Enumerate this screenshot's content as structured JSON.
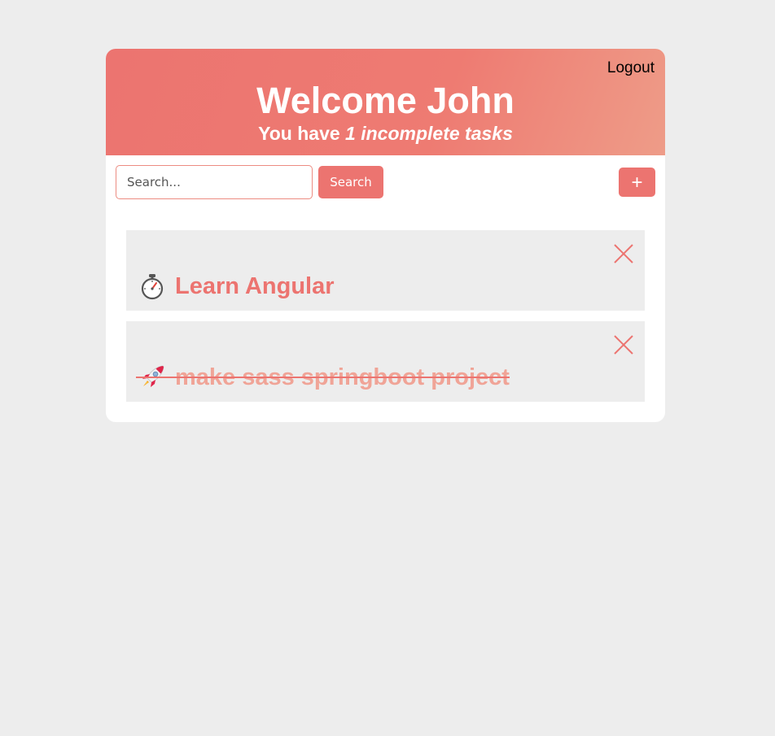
{
  "header": {
    "logout_label": "Logout",
    "welcome_prefix": "Welcome",
    "user_name": "John",
    "subtitle_prefix": "You have ",
    "incomplete_count": "1",
    "subtitle_suffix": " incomplete tasks"
  },
  "toolbar": {
    "search_placeholder": "Search...",
    "search_value": "",
    "search_button_label": "Search",
    "add_button_label": "+"
  },
  "tasks": [
    {
      "title": "Learn Angular",
      "icon": "stopwatch-icon",
      "completed": false
    },
    {
      "title": "make sass springboot project",
      "icon": "rocket-icon",
      "completed": true
    }
  ],
  "colors": {
    "accent": "#ec7470",
    "completed_text": "#f0a497",
    "background": "#ededed"
  }
}
